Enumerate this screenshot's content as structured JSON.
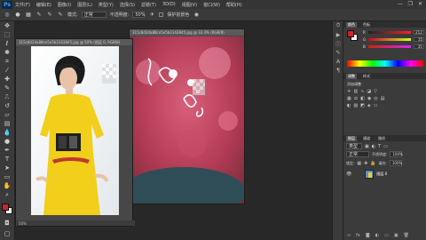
{
  "app": {
    "logo": "Ps"
  },
  "menu": [
    "文件(F)",
    "编辑(E)",
    "图像(I)",
    "图层(L)",
    "类型(Y)",
    "选择(S)",
    "滤镜(T)",
    "3D(D)",
    "视图(V)",
    "窗口(W)",
    "帮助(H)"
  ],
  "window_controls": [
    "—",
    "❐",
    "✕"
  ],
  "options": {
    "mode_label": "模式:",
    "mode_value": "正常",
    "opacity_label": "不透明度:",
    "opacity_value": "50%",
    "protect_label": "保护前景色"
  },
  "doc_back": {
    "title": "315c8d34a88ce5e5b3143845.jpg @ 33.3% (RGB/8)"
  },
  "doc_front": {
    "title": "315c8d34a88ce5e5b3143845.jpg @ 50% (图层 0, RGB/8)",
    "zoom": "50%"
  },
  "color_panel": {
    "tabs": [
      "颜色",
      "色板"
    ],
    "r_label": "R",
    "g_label": "G",
    "b_label": "B",
    "r": "212",
    "g": "35",
    "b": "35",
    "colors": {
      "foreground": "#d42323",
      "background": "#ffffff"
    }
  },
  "adjustments_panel": {
    "tabs": [
      "调整",
      "样式"
    ],
    "title": "添加调整"
  },
  "layers_panel": {
    "tabs": [
      "图层",
      "通道",
      "路径"
    ],
    "kind_label": "类型",
    "blend_mode": "正常",
    "opacity_label": "不透明度:",
    "opacity_value": "100%",
    "lock_label": "锁定:",
    "fill_label": "填充:",
    "fill_value": "100%",
    "layer_name": "图层 0"
  }
}
